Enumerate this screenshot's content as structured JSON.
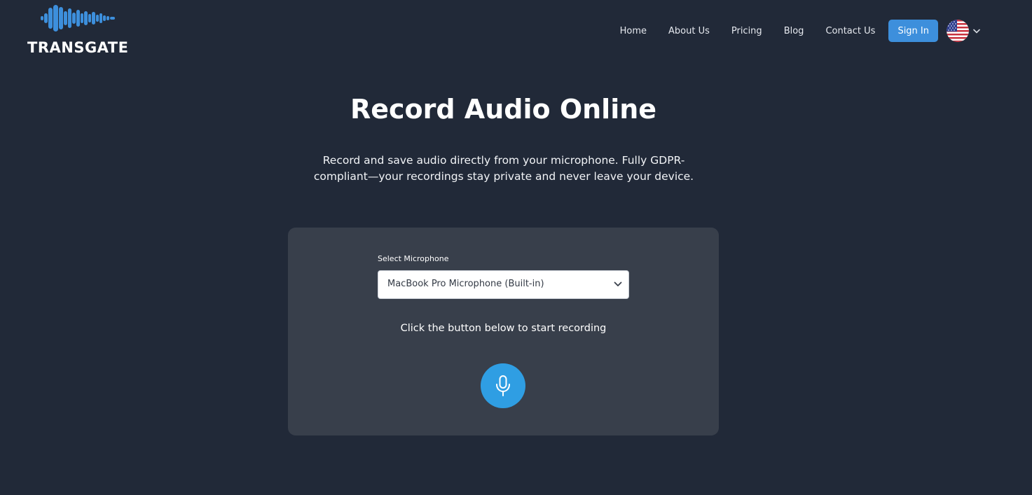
{
  "header": {
    "logo_text": "TRANSGATE",
    "nav": [
      {
        "label": "Home"
      },
      {
        "label": "About Us"
      },
      {
        "label": "Pricing"
      },
      {
        "label": "Blog"
      },
      {
        "label": "Contact Us"
      }
    ],
    "sign_in_label": "Sign In",
    "language_icon": "us-flag-icon"
  },
  "main": {
    "title": "Record Audio Online",
    "subtitle": "Record and save audio directly from your microphone. Fully GDPR-compliant—your recordings stay private and never leave your device."
  },
  "recorder": {
    "select_label": "Select Microphone",
    "selected_microphone": "MacBook Pro Microphone (Built-in)",
    "hint": "Click the button below to start recording",
    "record_icon": "microphone-icon"
  },
  "colors": {
    "background": "#212938",
    "card": "#383f4b",
    "accent": "#3d8fdc",
    "record_button": "#2f9ee3",
    "logo_wave": "#3d8fdc"
  }
}
